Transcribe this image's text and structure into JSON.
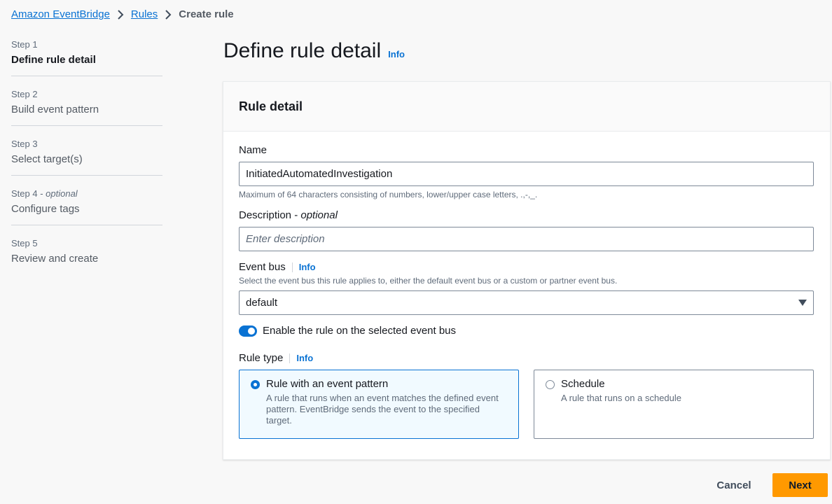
{
  "breadcrumb": {
    "items": [
      "Amazon EventBridge",
      "Rules"
    ],
    "current": "Create rule"
  },
  "steps": [
    {
      "num": "Step 1",
      "optional": "",
      "title": "Define rule detail",
      "active": true
    },
    {
      "num": "Step 2",
      "optional": "",
      "title": "Build event pattern"
    },
    {
      "num": "Step 3",
      "optional": "",
      "title": "Select target(s)"
    },
    {
      "num": "Step 4",
      "optional": "optional",
      "title": "Configure tags"
    },
    {
      "num": "Step 5",
      "optional": "",
      "title": "Review and create"
    }
  ],
  "page": {
    "title": "Define rule detail",
    "info": "Info"
  },
  "panel": {
    "title": "Rule detail",
    "name_label": "Name",
    "name_value": "InitiatedAutomatedInvestigation",
    "name_hint": "Maximum of 64 characters consisting of numbers, lower/upper case letters, .,-,_.",
    "description_label": "Description - ",
    "description_optional": "optional",
    "description_placeholder": "Enter description",
    "event_bus_label": "Event bus",
    "event_bus_info": "Info",
    "event_bus_hint": "Select the event bus this rule applies to, either the default event bus or a custom or partner event bus.",
    "event_bus_value": "default",
    "toggle_label": "Enable the rule on the selected event bus",
    "toggle_on": true,
    "rule_type_label": "Rule type",
    "rule_type_info": "Info",
    "rule_types": [
      {
        "title": "Rule with an event pattern",
        "desc": "A rule that runs when an event matches the defined event pattern. EventBridge sends the event to the specified target.",
        "selected": true
      },
      {
        "title": "Schedule",
        "desc": "A rule that runs on a schedule",
        "selected": false
      }
    ]
  },
  "footer": {
    "cancel": "Cancel",
    "next": "Next"
  },
  "colors": {
    "accent": "#0972d3",
    "primary_button": "#ff9900"
  }
}
